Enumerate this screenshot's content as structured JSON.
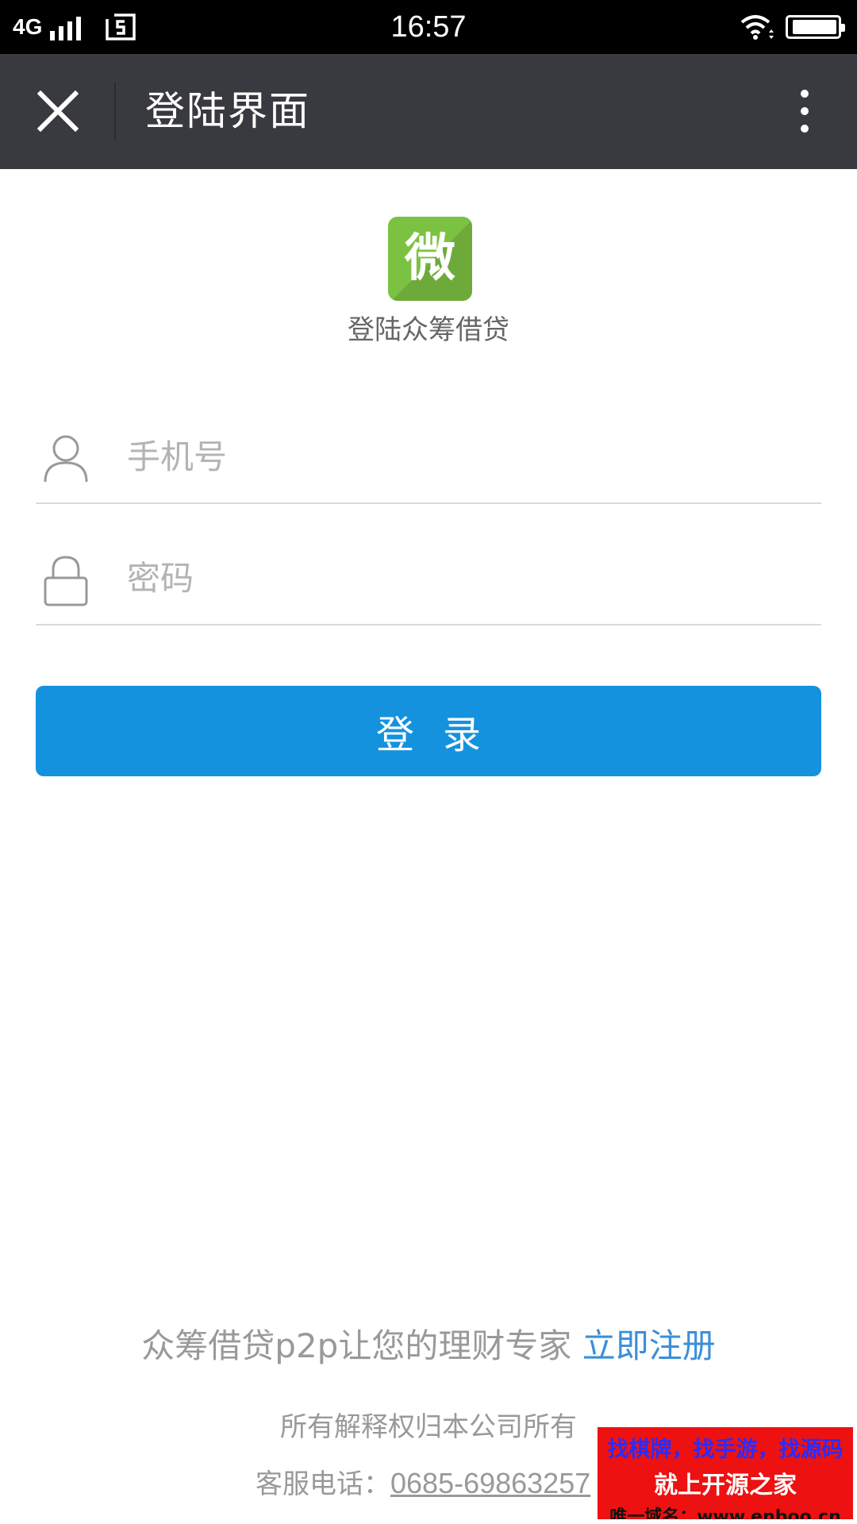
{
  "status_bar": {
    "network": "4G",
    "time": "16:57",
    "battery_level": 0.95
  },
  "header": {
    "title": "登陆界面",
    "close_icon": "close-icon",
    "more_icon": "more-vertical-icon"
  },
  "logo": {
    "glyph": "微",
    "caption": "登陆众筹借贷",
    "color": "#7cc242"
  },
  "form": {
    "phone_placeholder": "手机号",
    "phone_value": "",
    "password_placeholder": "密码",
    "password_value": "",
    "login_label": "登录"
  },
  "footer": {
    "tagline": "众筹借贷p2p让您的理财专家",
    "register_label": "立即注册",
    "rights": "所有解释权归本公司所有",
    "service_label": "客服电话：",
    "service_phone": "0685-69863257"
  },
  "watermark": {
    "line1": "找棋牌，找手游，找源码",
    "line2": "就上开源之家",
    "line3": "唯一域名：www.enboo.cn"
  },
  "colors": {
    "header_bg": "#393a3f",
    "primary_button": "#1492de",
    "link": "#3a8fd9",
    "watermark_bg": "#ee1111"
  }
}
